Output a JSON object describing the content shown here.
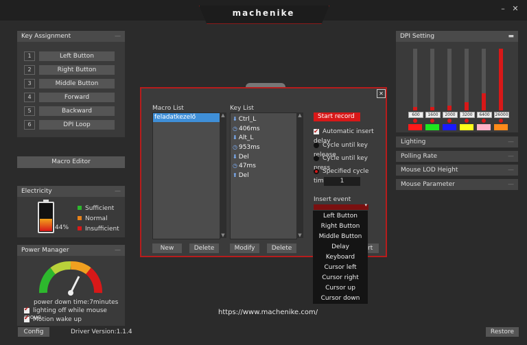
{
  "app": {
    "logo": "machenike",
    "minimize": "–",
    "close": "✕"
  },
  "key_assignment": {
    "title": "Key Assignment",
    "keys": [
      {
        "num": "1",
        "label": "Left Button"
      },
      {
        "num": "2",
        "label": "Right Button"
      },
      {
        "num": "3",
        "label": "Middle Button"
      },
      {
        "num": "4",
        "label": "Forward"
      },
      {
        "num": "5",
        "label": "Backward"
      },
      {
        "num": "6",
        "label": "DPI Loop"
      }
    ],
    "macro_editor": "Macro Editor"
  },
  "electricity": {
    "title": "Electricity",
    "percent": "44%",
    "level": 0.44,
    "legend": [
      {
        "label": "Sufficient",
        "color": "#2db82d"
      },
      {
        "label": "Normal",
        "color": "#e8821a"
      },
      {
        "label": "Insufficient",
        "color": "#d81818"
      }
    ]
  },
  "power_manager": {
    "title": "Power Manager",
    "power_down": "power down time:7minutes",
    "lighting_off": "lighting off while mouse move",
    "motion_wake": "Motion wake up"
  },
  "footer": {
    "config": "Config",
    "driver_version": "Driver Version:1.1.4",
    "url": "https://www.machenike.com/",
    "restore": "Restore"
  },
  "dpi": {
    "title": "DPI Setting",
    "levels": [
      {
        "value": "600",
        "fill": 0.05,
        "color": "#ff1a1a"
      },
      {
        "value": "1600",
        "fill": 0.05,
        "color": "#1ee61e"
      },
      {
        "value": "2000",
        "fill": 0.08,
        "color": "#1a1aff"
      },
      {
        "value": "3200",
        "fill": 0.13,
        "color": "#ffff1a"
      },
      {
        "value": "6400",
        "fill": 0.28,
        "color": "#ffb3c8"
      },
      {
        "value": "26000",
        "fill": 1.0,
        "color": "#ff8a1a"
      }
    ]
  },
  "side_menu": [
    "Lighting",
    "Polling Rate",
    "Mouse LOD Height",
    "Mouse Parameter"
  ],
  "macro_dialog": {
    "close": "✕",
    "macro_list_label": "Macro List",
    "macros": [
      "feladatkezelő"
    ],
    "key_list_label": "Key List",
    "keys": [
      {
        "icon": "down-arrow-icon",
        "text": "Ctrl_L"
      },
      {
        "icon": "clock-icon",
        "text": "406ms"
      },
      {
        "icon": "down-arrow-icon",
        "text": "Alt_L"
      },
      {
        "icon": "clock-icon",
        "text": "953ms"
      },
      {
        "icon": "down-arrow-icon",
        "text": "Del"
      },
      {
        "icon": "clock-icon",
        "text": "47ms"
      },
      {
        "icon": "up-arrow-icon",
        "text": "Del"
      }
    ],
    "start_record": "Start record",
    "auto_delay": "Automatic insert delay",
    "cycle_release": "Cycle until key release",
    "cycle_press": "Cycle until key press",
    "specified_cycles": "Specified cycle times",
    "cycle_count": "1",
    "insert_event": "Insert event",
    "new": "New",
    "delete1": "Delete",
    "modify": "Modify",
    "delete2": "Delete",
    "hidden_btn_tail": "rt",
    "dropdown": [
      "Left Button",
      "Right Button",
      "Middle Button",
      "Delay",
      "Keyboard",
      "Cursor left",
      "Cursor right",
      "Cursor up",
      "Cursor down"
    ]
  }
}
